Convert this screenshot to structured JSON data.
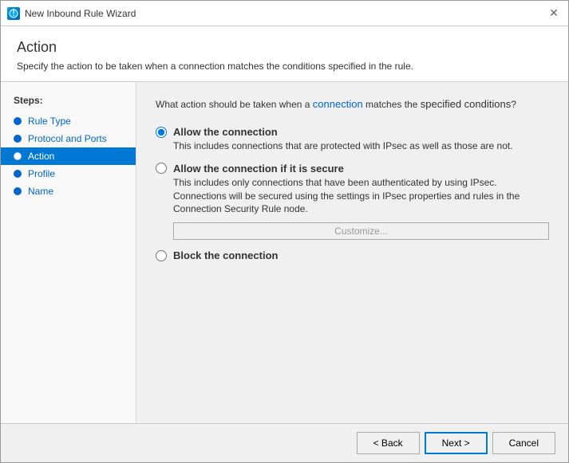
{
  "window": {
    "title": "New Inbound Rule Wizard",
    "close_label": "✕"
  },
  "header": {
    "title": "Action",
    "description": "Specify the action to be taken when a connection matches the conditions specified in the rule."
  },
  "steps": {
    "label": "Steps:",
    "items": [
      {
        "id": "rule-type",
        "label": "Rule Type",
        "active": false
      },
      {
        "id": "protocol-and-ports",
        "label": "Protocol and Ports",
        "active": false
      },
      {
        "id": "action",
        "label": "Action",
        "active": true
      },
      {
        "id": "profile",
        "label": "Profile",
        "active": false
      },
      {
        "id": "name",
        "label": "Name",
        "active": false
      }
    ]
  },
  "content": {
    "question": "What action should be taken when a connection matches the specified conditions?",
    "options": [
      {
        "id": "allow",
        "label": "Allow the connection",
        "description": "This includes connections that are protected with IPsec as well as those are not.",
        "checked": true
      },
      {
        "id": "allow-secure",
        "label": "Allow the connection if it is secure",
        "description": "This includes only connections that have been authenticated by using IPsec. Connections will be secured using the settings in IPsec properties and rules in the Connection Security Rule node.",
        "checked": false,
        "has_customize": true,
        "customize_label": "Customize..."
      },
      {
        "id": "block",
        "label": "Block the connection",
        "description": null,
        "checked": false
      }
    ]
  },
  "footer": {
    "back_label": "< Back",
    "next_label": "Next >",
    "cancel_label": "Cancel"
  }
}
